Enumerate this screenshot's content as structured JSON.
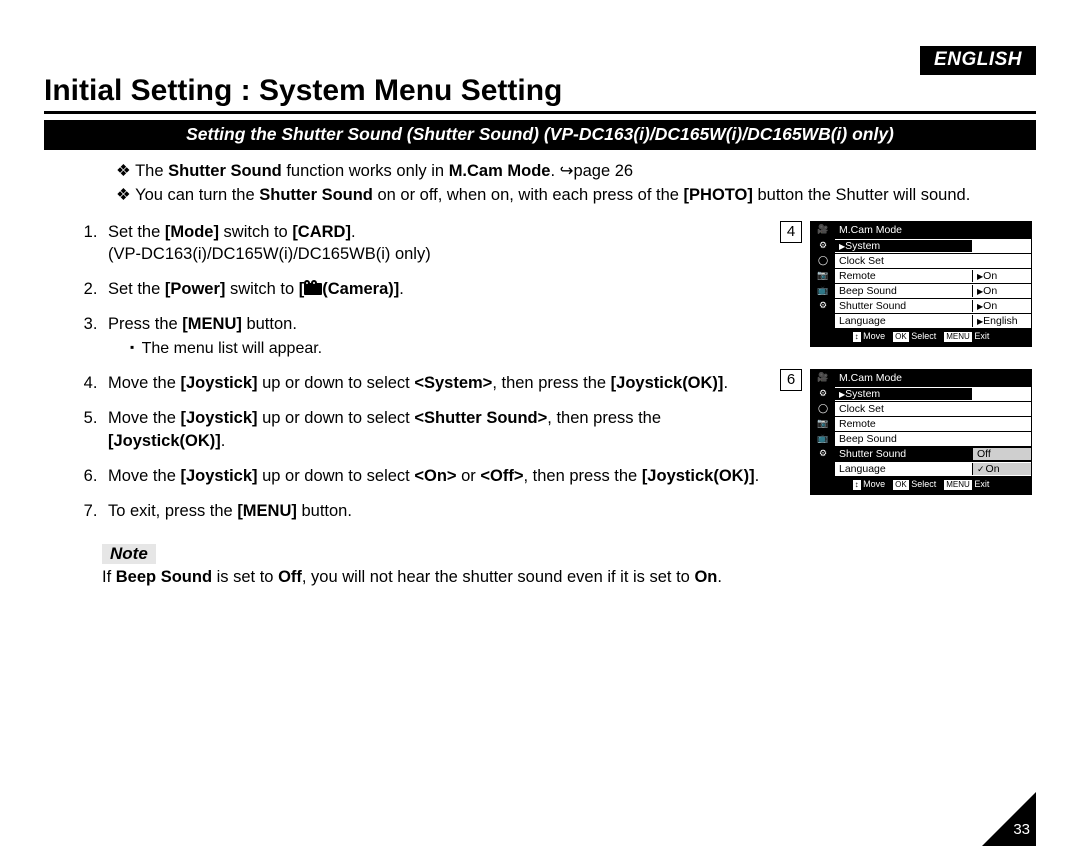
{
  "language_tag": "ENGLISH",
  "title": "Initial Setting : System Menu Setting",
  "subtitle": "Setting the Shutter Sound (Shutter Sound) (VP-DC163(i)/DC165W(i)/DC165WB(i) only)",
  "intro_parts": {
    "b1_pre": "The ",
    "b1_bold1": "Shutter Sound",
    "b1_mid": " function works only in ",
    "b1_bold2": "M.Cam Mode",
    "b1_post": ". ",
    "b1_pageref": "page 26",
    "b2_pre": "You can turn the ",
    "b2_bold1": "Shutter Sound",
    "b2_mid": " on or off, when on, with each press of the ",
    "b2_bold2": "[PHOTO]",
    "b2_post": " button the Shutter will sound."
  },
  "steps": {
    "s1a": "Set the ",
    "s1b": "[Mode]",
    "s1c": " switch to ",
    "s1d": "[CARD]",
    "s1e": ".",
    "s1_sub": "(VP-DC163(i)/DC165W(i)/DC165WB(i) only)",
    "s2a": "Set the ",
    "s2b": "[Power]",
    "s2c": " switch to ",
    "s2d": "[",
    "s2e": "(Camera)]",
    "s2f": ".",
    "s3a": "Press the ",
    "s3b": "[MENU]",
    "s3c": " button.",
    "s3_li": "The menu list will appear.",
    "s4a": "Move the ",
    "s4b": "[Joystick]",
    "s4c": " up or down to select ",
    "s4d": "<System>",
    "s4e": ", then press the ",
    "s4f": "[Joystick(OK)]",
    "s4g": ".",
    "s5a": "Move the ",
    "s5b": "[Joystick]",
    "s5c": " up or down to select ",
    "s5d": "<Shutter Sound>",
    "s5e": ", then press the ",
    "s5f": "[Joystick(OK)]",
    "s5g": ".",
    "s6a": "Move the ",
    "s6b": "[Joystick]",
    "s6c": " up or down to select ",
    "s6d": "<On>",
    "s6e": " or ",
    "s6f": "<Off>",
    "s6g": ", then press the ",
    "s6h": "[Joystick(OK)]",
    "s6i": ".",
    "s7a": "To exit, press the ",
    "s7b": "[MENU]",
    "s7c": " button."
  },
  "note_label": "Note",
  "note_parts": {
    "a": "If ",
    "b": "Beep Sound",
    "c": " is set to ",
    "d": "Off",
    "e": ", you will not hear the shutter sound even if it is set to ",
    "f": "On",
    "g": "."
  },
  "panel_common": {
    "mode": "M.Cam Mode",
    "system": "System",
    "clock": "Clock Set",
    "remote": "Remote",
    "beep": "Beep Sound",
    "shutter": "Shutter Sound",
    "lang": "Language",
    "on": "On",
    "off": "Off",
    "english": "English",
    "move": "Move",
    "select": "Select",
    "exit": "Exit",
    "ok": "OK",
    "menu": "MENU",
    "arrows_icon": "↕"
  },
  "panel4_badge": "4",
  "panel6_badge": "6",
  "page_number": "33"
}
